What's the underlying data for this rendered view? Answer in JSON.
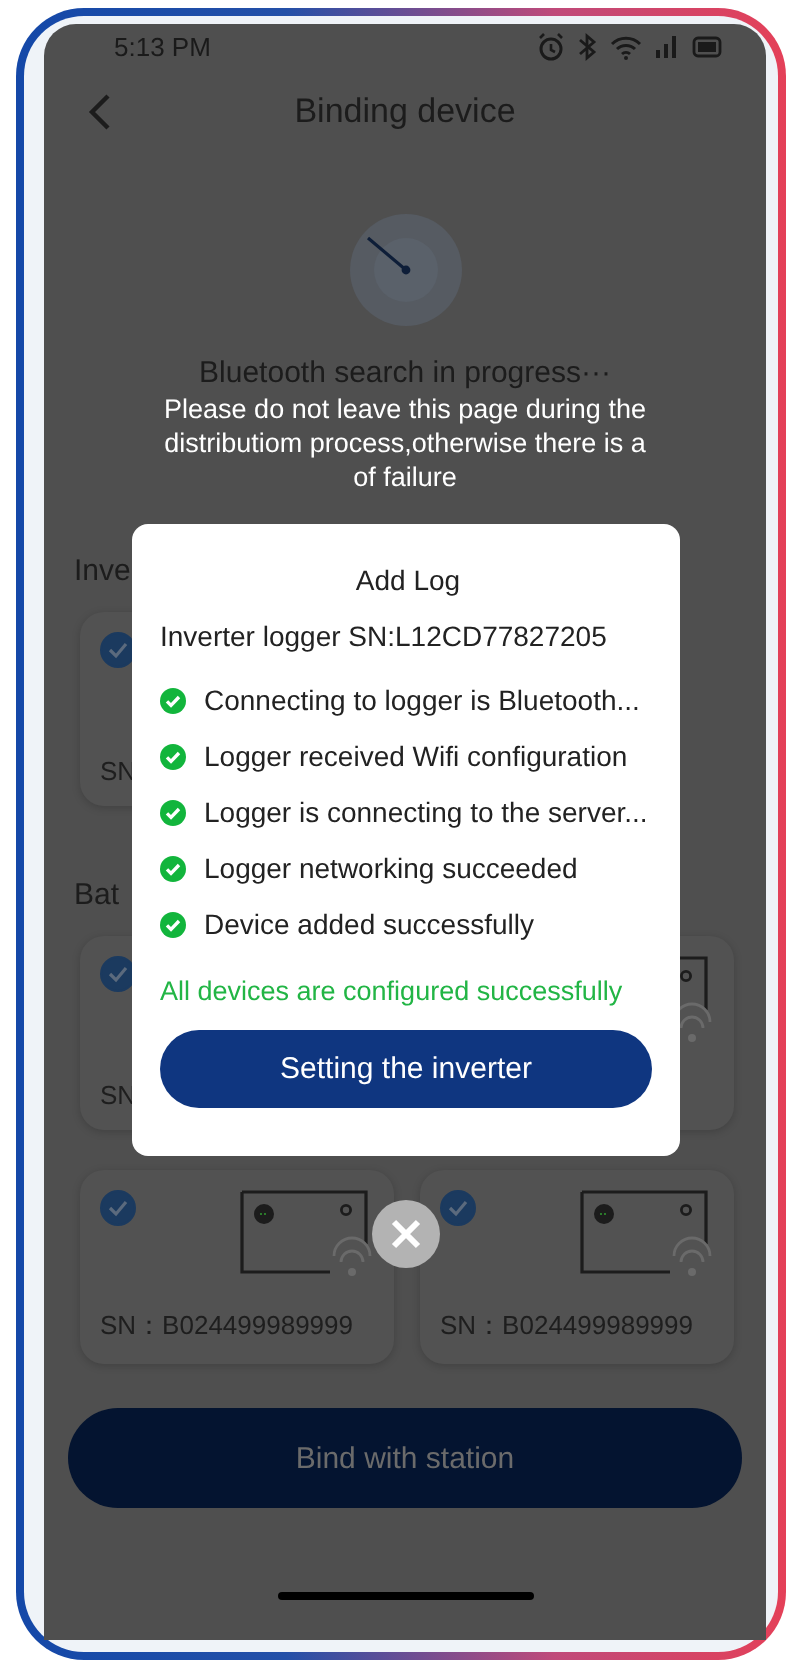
{
  "status_bar": {
    "time": "5:13 PM"
  },
  "header": {
    "title": "Binding device"
  },
  "search": {
    "status": "Bluetooth search in progress···"
  },
  "toast": {
    "message": "Please do not leave this page during the\ndistributiom process,otherwise there is a\nof failure"
  },
  "inverter_section": {
    "label": "Inve",
    "cards": [
      {
        "checked": true,
        "sn": "SN"
      }
    ]
  },
  "battery_section": {
    "label": "Bat",
    "cards": [
      {
        "checked": true,
        "sn": "SN",
        "kind": "covered"
      },
      {
        "kind": "device"
      },
      {
        "checked": true,
        "sn": "SN：B024499989999",
        "kind": "device"
      },
      {
        "checked": true,
        "sn": "SN：B024499989999",
        "kind": "device"
      }
    ]
  },
  "bind_button": {
    "label": "Bind with station",
    "disabled": true
  },
  "dialog": {
    "title": "Add Log",
    "subtitle": "Inverter logger SN:L12CD77827205",
    "steps": [
      {
        "text": "Connecting to logger is Bluetooth...",
        "done": true
      },
      {
        "text": "Logger received Wifi configuration",
        "done": true
      },
      {
        "text": "Logger is connecting to the server...",
        "done": true
      },
      {
        "text": "Logger networking succeeded",
        "done": true
      },
      {
        "text": "Device added successfully",
        "done": true
      }
    ],
    "result": "All devices are configured successfully",
    "button": "Setting the inverter"
  }
}
